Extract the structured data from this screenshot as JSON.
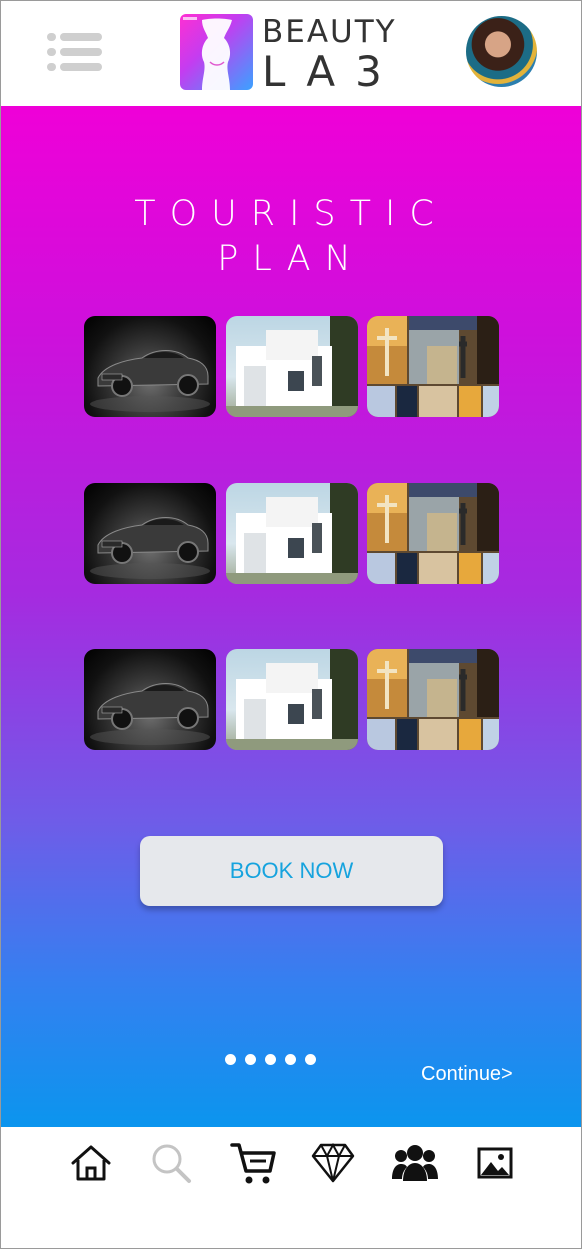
{
  "header": {
    "menu_icon": "hamburger-list-icon",
    "logo_line1": "BEAUTY",
    "logo_line2": "LA3",
    "avatar_alt": "user-profile-avatar"
  },
  "main": {
    "title_line1": "TOURISTIC",
    "title_line2": "PLAN",
    "rows": [
      {
        "items": [
          "car-photo",
          "villa-photo",
          "city-collage-photo"
        ]
      },
      {
        "items": [
          "car-photo",
          "villa-photo",
          "city-collage-photo"
        ]
      },
      {
        "items": [
          "car-photo",
          "villa-photo",
          "city-collage-photo"
        ]
      }
    ],
    "book_label": "BOOK NOW",
    "pager_count": 5,
    "continue_label": "Continue>"
  },
  "bottom_nav": {
    "items": [
      "home-icon",
      "search-icon",
      "cart-icon",
      "diamond-icon",
      "users-icon",
      "image-icon"
    ]
  },
  "colors": {
    "gradient_top": "#ef00d8",
    "gradient_bottom": "#0b95ee",
    "button_text": "#16a3de",
    "button_bg": "#e6e8ec"
  }
}
